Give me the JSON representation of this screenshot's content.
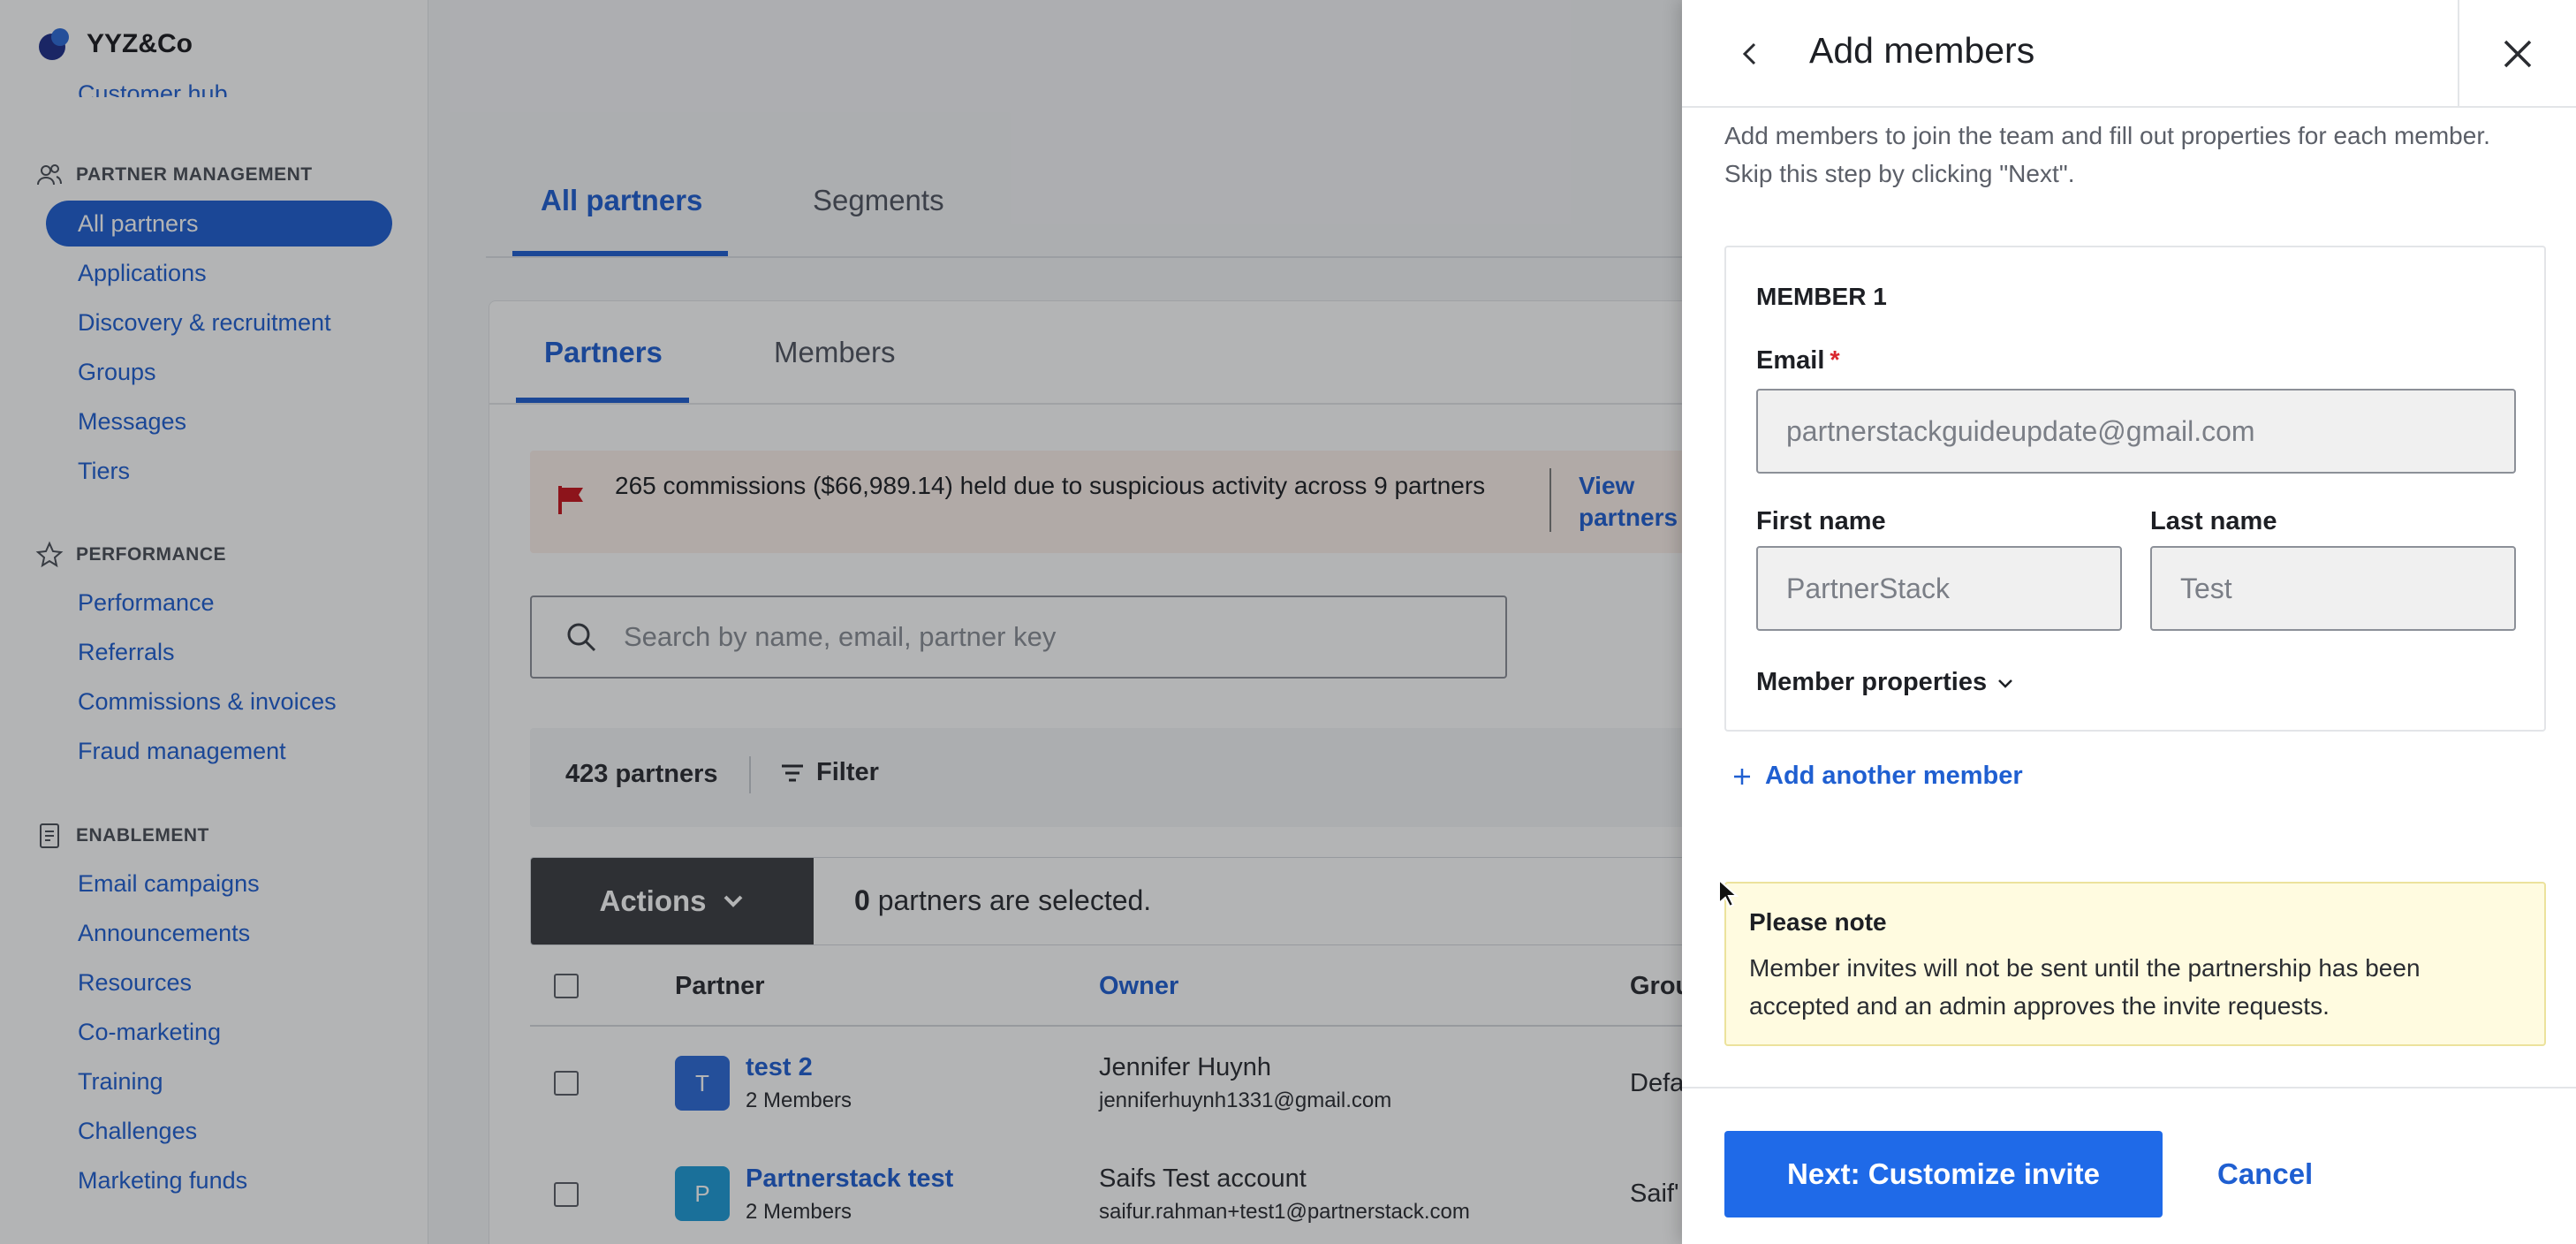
{
  "app": {
    "brand": "YYZ&Co",
    "cut_link": "Customer hub",
    "sections": [
      {
        "label": "PARTNER MANAGEMENT",
        "icon": "users-icon",
        "items": [
          "All partners",
          "Applications",
          "Discovery & recruitment",
          "Groups",
          "Messages",
          "Tiers"
        ]
      },
      {
        "label": "PERFORMANCE",
        "icon": "star-icon",
        "items": [
          "Performance",
          "Referrals",
          "Commissions & invoices",
          "Fraud management"
        ]
      },
      {
        "label": "ENABLEMENT",
        "icon": "document-icon",
        "items": [
          "Email campaigns",
          "Announcements",
          "Resources",
          "Co-marketing",
          "Training",
          "Challenges",
          "Marketing funds"
        ]
      }
    ]
  },
  "main": {
    "tabs": [
      "All partners",
      "Segments"
    ],
    "subtabs": [
      "Partners",
      "Members"
    ],
    "alert": {
      "text": "265 commissions ($66,989.14) held due to suspicious activity across 9 partners",
      "link": "View partners"
    },
    "search_placeholder": "Search by name, email, partner key",
    "count": "423 partners",
    "filter": "Filter",
    "actions": "Actions",
    "selected_count": "0",
    "selected_text": "partners are selected.",
    "columns": [
      "Partner",
      "Owner",
      "Grou"
    ],
    "rows": [
      {
        "initial": "T",
        "name": "test 2",
        "members": "2 Members",
        "owner": "Jennifer Huynh",
        "email": "jenniferhuynh1331@gmail.com",
        "group": "Defa",
        "color": "#2d6bd8"
      },
      {
        "initial": "P",
        "name": "Partnerstack test",
        "members": "2 Members",
        "owner": "Saifs Test account",
        "email": "saifur.rahman+test1@partnerstack.com",
        "group": "Saif'",
        "color": "#1e9bd8"
      }
    ]
  },
  "drawer": {
    "title": "Add members",
    "description": "Add members to join the team and fill out properties for each member. Skip this step by clicking \"Next\".",
    "member": {
      "title": "MEMBER 1",
      "email_label": "Email",
      "required_mark": "*",
      "email_value": "partnerstackguideupdate@gmail.com",
      "first_label": "First name",
      "first_value": "PartnerStack",
      "last_label": "Last name",
      "last_value": "Test",
      "props_label": "Member properties"
    },
    "add_another": "Add another member",
    "note": {
      "title": "Please note",
      "body": "Member invites will not be sent until the partnership has been accepted and an admin approves the invite requests."
    },
    "next": "Next: Customize invite",
    "cancel": "Cancel"
  },
  "colors": {
    "accent": "#1f5fd1",
    "primary_button": "#1f6ae8",
    "alert_flag": "#c8141c",
    "note_bg": "#fffbe0"
  }
}
